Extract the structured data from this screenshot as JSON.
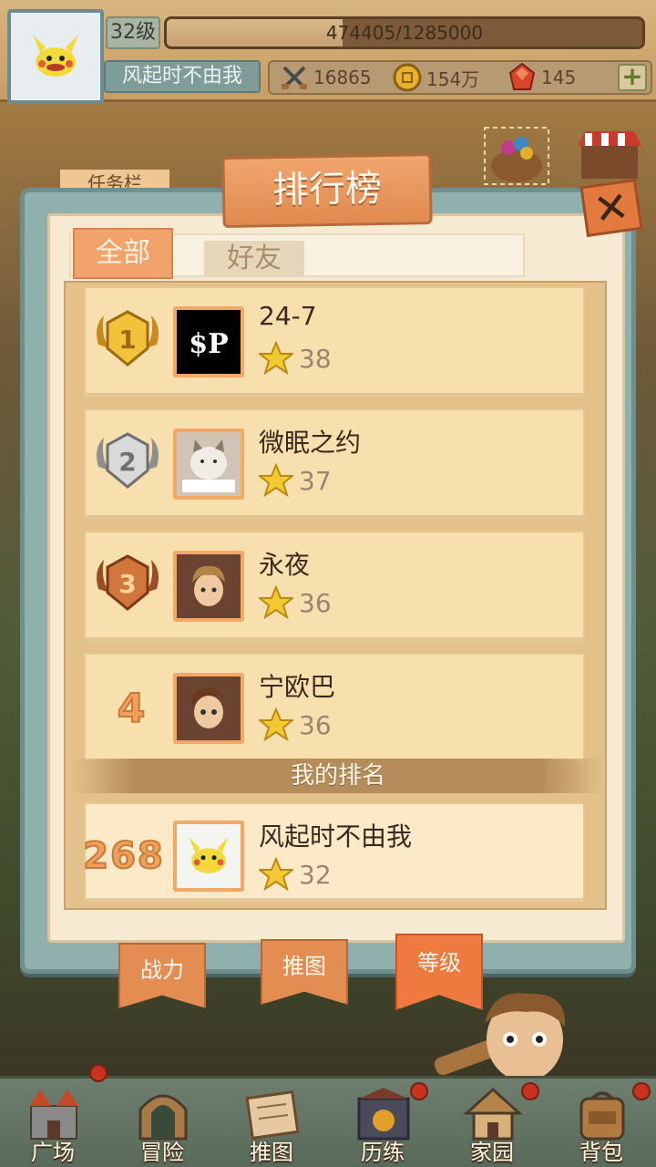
{
  "player": {
    "level_label": "32级",
    "exp_text": "474405/1285000",
    "exp_fraction": 0.369,
    "name": "风起时不由我"
  },
  "resources": {
    "power": "16865",
    "gold": "154万",
    "gems": "145"
  },
  "background": {
    "task_tab": "任务栏"
  },
  "modal": {
    "title": "排行榜",
    "tabs": [
      "全部",
      "好友"
    ],
    "my_rank_label": "我的排名",
    "entries": [
      {
        "rank": "1",
        "name": "24-7",
        "score": "38"
      },
      {
        "rank": "2",
        "name": "微眠之约",
        "score": "37"
      },
      {
        "rank": "3",
        "name": "永夜",
        "score": "36"
      },
      {
        "rank": "4",
        "name": "宁欧巴",
        "score": "36"
      }
    ],
    "me": {
      "rank": "268",
      "name": "风起时不由我",
      "score": "32"
    },
    "category_ribbons": [
      "战力",
      "推图",
      "等级"
    ],
    "active_ribbon": "等级"
  },
  "nav": {
    "items": [
      "广场",
      "冒险",
      "推图",
      "历练",
      "家园",
      "背包"
    ]
  },
  "colors": {
    "accent_orange": "#ee7a40",
    "panel_teal": "#8fb0ad",
    "row_bg": "#f8dfae"
  }
}
